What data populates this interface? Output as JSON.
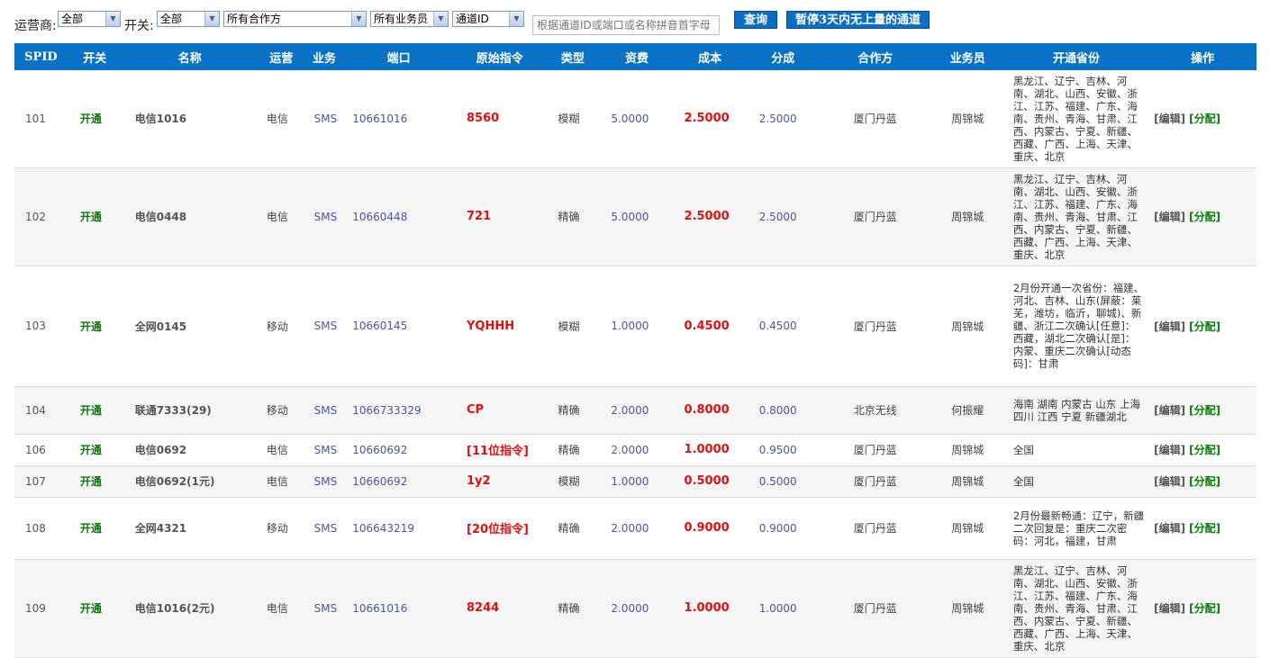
{
  "filters": {
    "operator_label": "运营商:",
    "operator_value": "全部",
    "switch_label": "开关:",
    "switch_value": "全部",
    "partner_value": "所有合作方",
    "staff_value": "所有业务员",
    "sort_value": "通道ID",
    "search_placeholder": "根据通道ID或端口或名称拼音首字母",
    "query_button": "查询",
    "pause_button": "暂停3天内无上量的通道"
  },
  "table": {
    "headers": [
      "SPID",
      "开关",
      "名称",
      "运营",
      "业务",
      "端口",
      "原始指令",
      "类型",
      "资费",
      "成本",
      "分成",
      "合作方",
      "业务员",
      "开通省份",
      "操作"
    ],
    "edit_label": "[编辑]",
    "alloc_label": "[分配]",
    "rows": [
      {
        "spid": "101",
        "switch": "开通",
        "name": "电信1016",
        "op": "电信",
        "biz": "SMS",
        "port": "10661016",
        "cmd": "8560",
        "type": "模糊",
        "fee": "5.0000",
        "cost": "2.5000",
        "share": "2.5000",
        "partner": "厦门丹蓝",
        "staff": "周锦城",
        "prov": "黑龙江、辽宁、吉林、河南、湖北、山西、安徽、浙江、江苏、福建、广东、海南、贵州、青海、甘肃、江西、内蒙古、宁夏、新疆、西藏、广西、上海、天津、重庆、北京"
      },
      {
        "spid": "102",
        "switch": "开通",
        "name": "电信0448",
        "op": "电信",
        "biz": "SMS",
        "port": "10660448",
        "cmd": "721",
        "type": "精确",
        "fee": "5.0000",
        "cost": "2.5000",
        "share": "2.5000",
        "partner": "厦门丹蓝",
        "staff": "周锦城",
        "prov": "黑龙江、辽宁、吉林、河南、湖北、山西、安徽、浙江、江苏、福建、广东、海南、贵州、青海、甘肃、江西、内蒙古、宁夏、新疆、西藏、广西、上海、天津、重庆、北京"
      },
      {
        "spid": "103",
        "switch": "开通",
        "name": "全网0145",
        "op": "移动",
        "biz": "SMS",
        "port": "10660145",
        "cmd": "YQHHH",
        "type": "模糊",
        "fee": "1.0000",
        "cost": "0.4500",
        "share": "0.4500",
        "partner": "厦门丹蓝",
        "staff": "周锦城",
        "prov": "2月份开通一次省份：福建、河北、吉林、山东(屏蔽：莱芜，潍坊，临沂，聊城)、新疆、浙江二次确认[任意]：西藏，湖北二次确认[是]：内蒙、重庆二次确认[动态码]：甘肃"
      },
      {
        "spid": "104",
        "switch": "开通",
        "name": "联通7333(29)",
        "op": "移动",
        "biz": "SMS",
        "port": "1066733329",
        "cmd": "CP",
        "type": "精确",
        "fee": "2.0000",
        "cost": "0.8000",
        "share": "0.8000",
        "partner": "北京无线",
        "staff": "何振耀",
        "prov": "海南 湖南 内蒙古 山东 上海 四川 江西 宁夏 新疆湖北"
      },
      {
        "spid": "106",
        "switch": "开通",
        "name": "电信0692",
        "op": "电信",
        "biz": "SMS",
        "port": "10660692",
        "cmd": "[11位指令]",
        "type": "精确",
        "fee": "2.0000",
        "cost": "1.0000",
        "share": "0.9500",
        "partner": "厦门丹蓝",
        "staff": "周锦城",
        "prov": "全国"
      },
      {
        "spid": "107",
        "switch": "开通",
        "name": "电信0692(1元)",
        "op": "电信",
        "biz": "SMS",
        "port": "10660692",
        "cmd": "1y2",
        "type": "模糊",
        "fee": "1.0000",
        "cost": "0.5000",
        "share": "0.5000",
        "partner": "厦门丹蓝",
        "staff": "周锦城",
        "prov": "全国"
      },
      {
        "spid": "108",
        "switch": "开通",
        "name": "全网4321",
        "op": "移动",
        "biz": "SMS",
        "port": "106643219",
        "cmd": "[20位指令]",
        "type": "精确",
        "fee": "2.0000",
        "cost": "0.9000",
        "share": "0.9000",
        "partner": "厦门丹蓝",
        "staff": "周锦城",
        "prov": "2月份最新畅通：辽宁，新疆二次回复是：重庆二次密码：河北，福建，甘肃"
      },
      {
        "spid": "109",
        "switch": "开通",
        "name": "电信1016(2元)",
        "op": "电信",
        "biz": "SMS",
        "port": "10661016",
        "cmd": "8244",
        "type": "精确",
        "fee": "2.0000",
        "cost": "1.0000",
        "share": "1.0000",
        "partner": "厦门丹蓝",
        "staff": "周锦城",
        "prov": "黑龙江、辽宁、吉林、河南、湖北、山西、安徽、浙江、江苏、福建、广东、海南、贵州、青海、甘肃、江西、内蒙古、宁夏、新疆、西藏、广西、上海、天津、重庆、北京"
      }
    ]
  }
}
